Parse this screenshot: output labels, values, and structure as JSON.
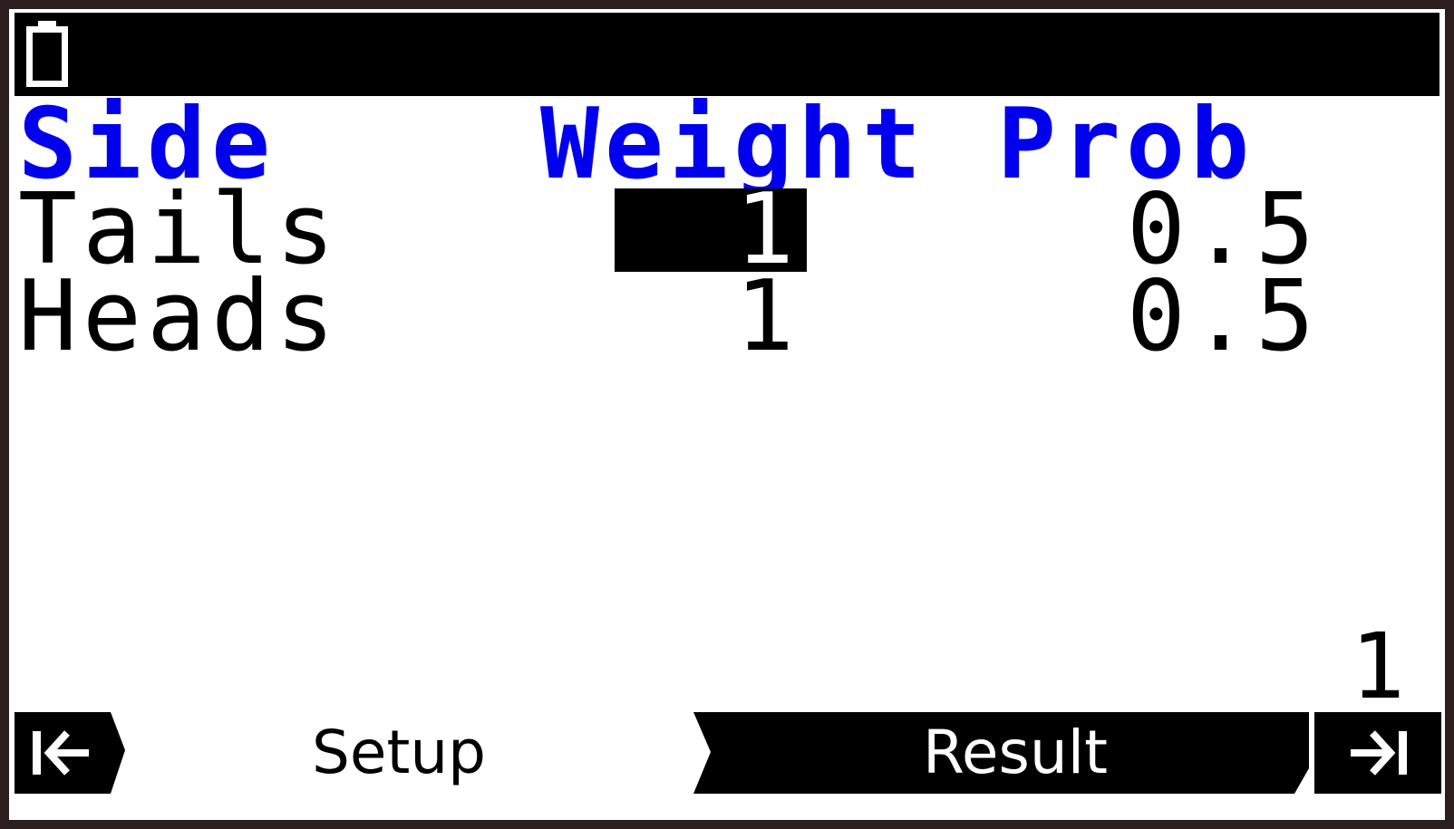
{
  "header": {
    "side": "Side",
    "weight": "Weight",
    "prob": "Prob"
  },
  "rows": [
    {
      "side": "Tails",
      "weight": "1",
      "prob": "0.5"
    },
    {
      "side": "Heads",
      "weight": "1",
      "prob": "0.5"
    }
  ],
  "page_indicator": "1",
  "softkeys": {
    "left_icon": "arrow-to-start-icon",
    "setup": "Setup",
    "result": "Result",
    "right_icon": "arrow-to-end-icon"
  },
  "status": {
    "battery_icon": "battery-icon"
  },
  "colors": {
    "header": "#0000ee",
    "text": "#000000",
    "background": "#ffffff"
  }
}
